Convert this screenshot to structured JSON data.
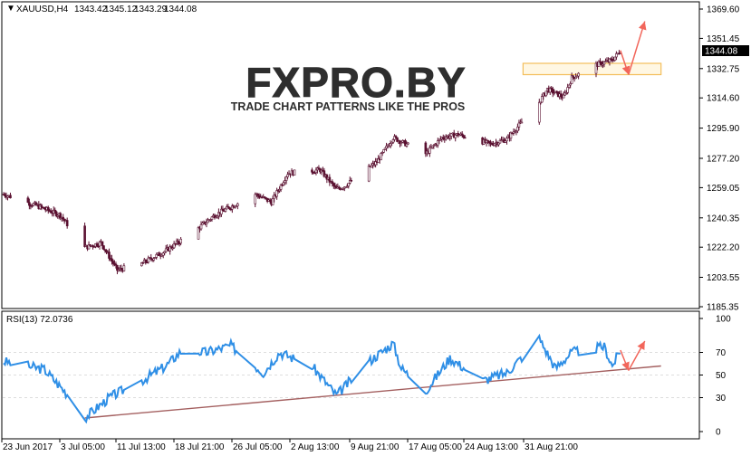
{
  "chart_data": [
    {
      "type": "candlestick",
      "title": "XAUUSD,H4",
      "ohlc_header": {
        "open": "1343.42",
        "high": "1345.12",
        "low": "1343.29",
        "close": "1344.08"
      },
      "current_price_label": "1344.08",
      "y_ticks": [
        "1369.60",
        "1351.45",
        "1332.75",
        "1314.60",
        "1295.90",
        "1277.20",
        "1259.05",
        "1240.35",
        "1222.20",
        "1203.55",
        "1185.35"
      ],
      "ylim": [
        1185.35,
        1369.6
      ],
      "x_tick_labels": [
        "23 Jun 2017",
        "3 Jul 05:00",
        "11 Jul 13:00",
        "18 Jul 21:00",
        "26 Jul 05:00",
        "2 Aug 13:00",
        "9 Aug 21:00",
        "17 Aug 05:00",
        "24 Aug 13:00",
        "31 Aug 21:00"
      ],
      "price_path_keypoints": [
        {
          "date": "2017-06-23",
          "price": 1255
        },
        {
          "date": "2017-06-27",
          "price": 1248
        },
        {
          "date": "2017-06-30",
          "price": 1242
        },
        {
          "date": "2017-07-03",
          "price": 1222
        },
        {
          "date": "2017-07-05",
          "price": 1225
        },
        {
          "date": "2017-07-07",
          "price": 1208
        },
        {
          "date": "2017-07-10",
          "price": 1212
        },
        {
          "date": "2017-07-13",
          "price": 1220
        },
        {
          "date": "2017-07-17",
          "price": 1234
        },
        {
          "date": "2017-07-19",
          "price": 1242
        },
        {
          "date": "2017-07-24",
          "price": 1255
        },
        {
          "date": "2017-07-26",
          "price": 1250
        },
        {
          "date": "2017-07-28",
          "price": 1268
        },
        {
          "date": "2017-08-01",
          "price": 1270
        },
        {
          "date": "2017-08-03",
          "price": 1258
        },
        {
          "date": "2017-08-04",
          "price": 1260
        },
        {
          "date": "2017-08-08",
          "price": 1275
        },
        {
          "date": "2017-08-10",
          "price": 1290
        },
        {
          "date": "2017-08-14",
          "price": 1280
        },
        {
          "date": "2017-08-16",
          "price": 1290
        },
        {
          "date": "2017-08-18",
          "price": 1292
        },
        {
          "date": "2017-08-22",
          "price": 1286
        },
        {
          "date": "2017-08-24",
          "price": 1289
        },
        {
          "date": "2017-08-28",
          "price": 1312
        },
        {
          "date": "2017-08-29",
          "price": 1320
        },
        {
          "date": "2017-08-31",
          "price": 1315
        },
        {
          "date": "2017-09-01",
          "price": 1327
        },
        {
          "date": "2017-09-04",
          "price": 1335
        },
        {
          "date": "2017-09-06",
          "price": 1338
        },
        {
          "date": "2017-09-07",
          "price": 1344
        }
      ],
      "support_zone": {
        "price_low": 1329,
        "price_high": 1336
      },
      "forecast_arrows": [
        {
          "from": {
            "date": "2017-09-07",
            "price": 1344
          },
          "to": {
            "date": "2017-09-08",
            "price": 1329
          }
        },
        {
          "from": {
            "date": "2017-09-08",
            "price": 1329
          },
          "to": {
            "date": "2017-09-10",
            "price": 1362
          }
        }
      ],
      "colors": {
        "bull": "#ffffff",
        "bear": "#5a1030",
        "wick": "#5a1030",
        "arrow": "#f2665b",
        "zone": "#f2b84a",
        "grid": "#dddddd"
      }
    },
    {
      "type": "line",
      "title": "RSI(13) 72.0736",
      "y_ticks": [
        "100",
        "70",
        "50",
        "30",
        "0"
      ],
      "ylim": [
        0,
        100
      ],
      "levels": [
        70,
        50,
        30
      ],
      "series": [
        {
          "keypoints": [
            {
              "date": "2017-06-23",
              "value": 62
            },
            {
              "date": "2017-06-28",
              "value": 55
            },
            {
              "date": "2017-07-01",
              "value": 32
            },
            {
              "date": "2017-07-03",
              "value": 12
            },
            {
              "date": "2017-07-06",
              "value": 30
            },
            {
              "date": "2017-07-10",
              "value": 45
            },
            {
              "date": "2017-07-13",
              "value": 58
            },
            {
              "date": "2017-07-15",
              "value": 72
            },
            {
              "date": "2017-07-18",
              "value": 70
            },
            {
              "date": "2017-07-21",
              "value": 76
            },
            {
              "date": "2017-07-25",
              "value": 52
            },
            {
              "date": "2017-07-27",
              "value": 70
            },
            {
              "date": "2017-07-31",
              "value": 58
            },
            {
              "date": "2017-08-03",
              "value": 32
            },
            {
              "date": "2017-08-07",
              "value": 62
            },
            {
              "date": "2017-08-10",
              "value": 78
            },
            {
              "date": "2017-08-11",
              "value": 56
            },
            {
              "date": "2017-08-14",
              "value": 36
            },
            {
              "date": "2017-08-17",
              "value": 65
            },
            {
              "date": "2017-08-21",
              "value": 45
            },
            {
              "date": "2017-08-24",
              "value": 52
            },
            {
              "date": "2017-08-28",
              "value": 82
            },
            {
              "date": "2017-08-30",
              "value": 56
            },
            {
              "date": "2017-09-01",
              "value": 70
            },
            {
              "date": "2017-09-05",
              "value": 75
            },
            {
              "date": "2017-09-06",
              "value": 58
            },
            {
              "date": "2017-09-07",
              "value": 72
            }
          ]
        }
      ],
      "trendline": {
        "from": {
          "date": "2017-07-03",
          "value": 12
        },
        "to": {
          "date": "2017-09-12",
          "value": 58
        }
      },
      "forecast_arrows": [
        {
          "from": {
            "date": "2017-09-07",
            "value": 72
          },
          "to": {
            "date": "2017-09-08",
            "value": 54
          }
        },
        {
          "from": {
            "date": "2017-09-08",
            "value": 54
          },
          "to": {
            "date": "2017-09-10",
            "value": 80
          }
        }
      ],
      "colors": {
        "line": "#2f8fe6",
        "trendline": "#a46060",
        "arrow": "#f2665b",
        "grid": "#dddddd"
      }
    }
  ],
  "watermark": {
    "text": "FXPRO.BY",
    "tagline": "TRADE CHART PATTERNS LIKE THE PROS"
  }
}
